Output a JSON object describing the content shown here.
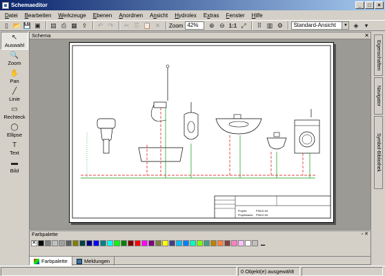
{
  "window": {
    "title": "Schemaeditor"
  },
  "menu": [
    {
      "pre": "",
      "u": "D",
      "post": "atei"
    },
    {
      "pre": "",
      "u": "B",
      "post": "earbeiten"
    },
    {
      "pre": "",
      "u": "W",
      "post": "erkzeuge"
    },
    {
      "pre": "",
      "u": "E",
      "post": "benen"
    },
    {
      "pre": "",
      "u": "A",
      "post": "nordnen"
    },
    {
      "pre": "A",
      "u": "n",
      "post": "sicht"
    },
    {
      "pre": "",
      "u": "H",
      "post": "ydrolex"
    },
    {
      "pre": "E",
      "u": "x",
      "post": "tras"
    },
    {
      "pre": "",
      "u": "F",
      "post": "enster"
    },
    {
      "pre": "",
      "u": "H",
      "post": "ilfe"
    }
  ],
  "toolbar": {
    "zoom_label": "Zoom",
    "zoom_value": "42%",
    "ratio_label": "1:1",
    "view_select": "Standard-Ansicht"
  },
  "tools": [
    {
      "label": "Auswahl",
      "icon": "cursor-icon",
      "glyph": "↖"
    },
    {
      "label": "Zoom",
      "icon": "magnifier-icon",
      "glyph": "🔍"
    },
    {
      "label": "Pan",
      "icon": "hand-icon",
      "glyph": "✋"
    },
    {
      "label": "Linie",
      "icon": "line-icon",
      "glyph": "╱"
    },
    {
      "label": "Rechteck",
      "icon": "rectangle-icon",
      "glyph": "▭"
    },
    {
      "label": "Ellipse",
      "icon": "ellipse-icon",
      "glyph": "◯"
    },
    {
      "label": "Text",
      "icon": "text-icon",
      "glyph": "T"
    },
    {
      "label": "Bild",
      "icon": "image-icon",
      "glyph": "▬"
    }
  ],
  "schema": {
    "title": "Schema",
    "titleblock": {
      "projekt_label": "Projekt:",
      "projekt_value": "PS612-K6",
      "projektname_label": "Projektname:",
      "projektname_value": "PS612-K6"
    }
  },
  "right_tabs": [
    "Eigenschaften",
    "Navigator",
    "Symbol-Bibliothek"
  ],
  "palette": {
    "title": "Farbpalette",
    "colors": [
      "#000000",
      "#808080",
      "#c0c0c0",
      "#a0a0a0",
      "#606060",
      "#808000",
      "#004040",
      "#000080",
      "#0000ff",
      "#008080",
      "#00ffff",
      "#00ff00",
      "#008000",
      "#800000",
      "#ff0000",
      "#ff00ff",
      "#800080",
      "#808040",
      "#ffff00",
      "#404080",
      "#00c0ff",
      "#0080ff",
      "#00ffc0",
      "#80ff00",
      "#40a080",
      "#c08000",
      "#ff8040",
      "#804040",
      "#ff80c0",
      "#ffc0ff",
      "#ffffff",
      "#c0c0c0"
    ],
    "extra": "▁",
    "tabs": [
      {
        "label": "Farbpalette",
        "icon": "palette-icon"
      },
      {
        "label": "Meldungen",
        "icon": "messages-icon"
      }
    ]
  },
  "status": {
    "text": "0 Objekt(e) ausgewählt"
  }
}
